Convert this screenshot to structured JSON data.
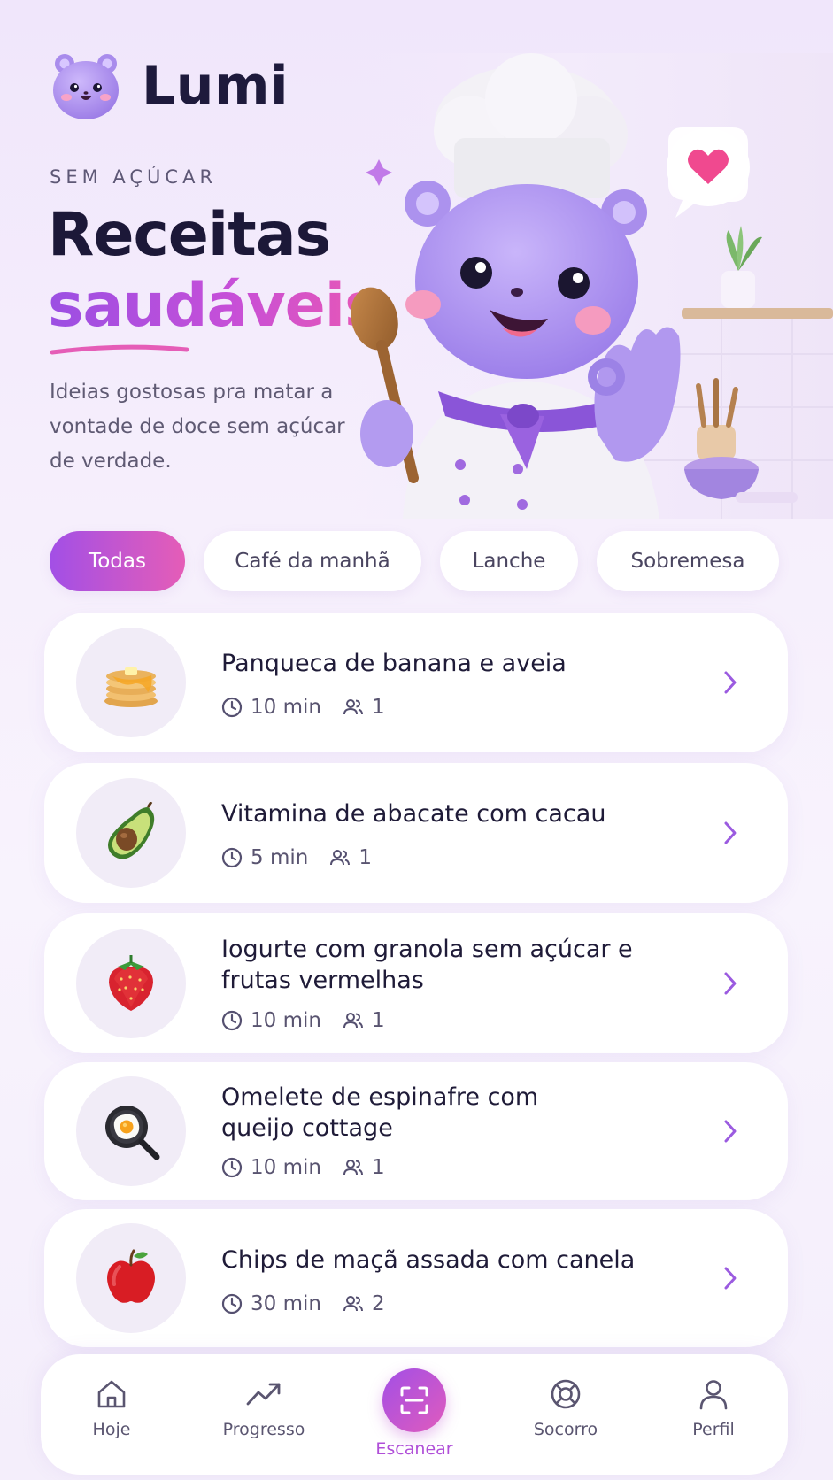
{
  "app": {
    "name": "Lumi"
  },
  "hero": {
    "eyebrow": "SEM AÇÚCAR",
    "title_line1": "Receitas",
    "title_line2": "saudáveis",
    "subtitle": "Ideias gostosas pra matar a vontade de doce sem açúcar de verdade."
  },
  "filters": [
    {
      "label": "Todas",
      "active": true
    },
    {
      "label": "Café da manhã",
      "active": false
    },
    {
      "label": "Lanche",
      "active": false
    },
    {
      "label": "Sobremesa",
      "active": false
    }
  ],
  "recipes": [
    {
      "title": "Panqueca de banana e aveia",
      "time": "10 min",
      "servings": "1",
      "icon": "pancakes-icon"
    },
    {
      "title": "Vitamina de abacate com cacau",
      "time": "5 min",
      "servings": "1",
      "icon": "avocado-icon"
    },
    {
      "title": "Iogurte com granola sem açúcar e frutas vermelhas",
      "time": "10 min",
      "servings": "1",
      "icon": "strawberry-icon"
    },
    {
      "title": "Omelete de espinafre com queijo cottage",
      "time": "10 min",
      "servings": "1",
      "icon": "frying-pan-egg-icon"
    },
    {
      "title": "Chips de maçã assada com canela",
      "time": "30 min",
      "servings": "2",
      "icon": "apple-icon"
    }
  ],
  "nav": [
    {
      "label": "Hoje",
      "icon": "home-icon",
      "active": false
    },
    {
      "label": "Progresso",
      "icon": "trending-up-icon",
      "active": false
    },
    {
      "label": "Escanear",
      "icon": "scan-icon",
      "active": true
    },
    {
      "label": "Socorro",
      "icon": "lifebuoy-icon",
      "active": false
    },
    {
      "label": "Perfil",
      "icon": "user-icon",
      "active": false
    }
  ],
  "colors": {
    "accent_start": "#a24fe6",
    "accent_end": "#e55db7",
    "text_dark": "#1c1838",
    "mascot": "#b59cf0"
  }
}
